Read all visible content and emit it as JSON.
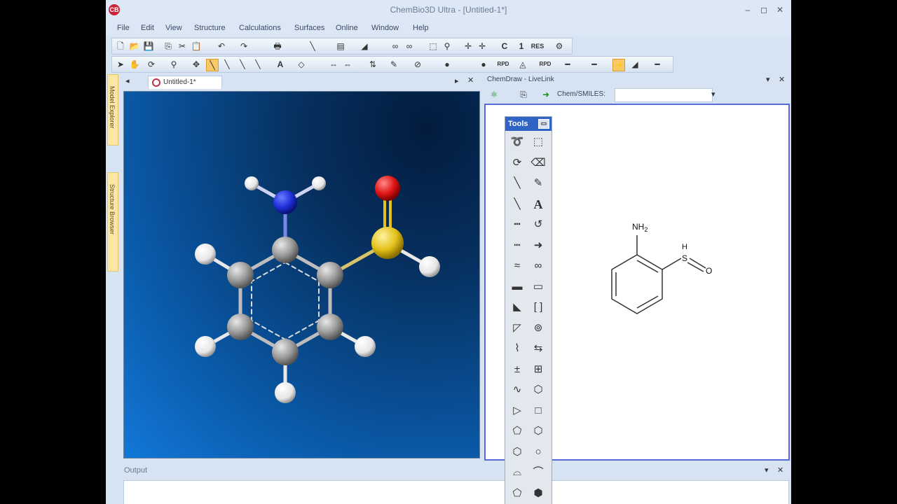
{
  "app": {
    "title": "ChemBio3D Ultra - [Untitled-1*]",
    "icon": "chembio-logo-icon",
    "window_buttons": [
      "–",
      "◻",
      "✕"
    ]
  },
  "menu": [
    "File",
    "Edit",
    "View",
    "Structure",
    "Calculations",
    "Surfaces",
    "Online",
    "Window",
    "Help"
  ],
  "side_tabs": [
    "Model Explorer",
    "Structure Browser"
  ],
  "document": {
    "tab_label": "Untitled-1*"
  },
  "model3d": {
    "atoms": [
      {
        "id": "C1",
        "element": "C",
        "color": "#9a9a9a"
      },
      {
        "id": "C2",
        "element": "C",
        "color": "#9a9a9a"
      },
      {
        "id": "C3",
        "element": "C",
        "color": "#9a9a9a"
      },
      {
        "id": "C4",
        "element": "C",
        "color": "#9a9a9a"
      },
      {
        "id": "C5",
        "element": "C",
        "color": "#9a9a9a"
      },
      {
        "id": "C6",
        "element": "C",
        "color": "#9a9a9a"
      },
      {
        "id": "N",
        "element": "N",
        "color": "#1f2fd8"
      },
      {
        "id": "S",
        "element": "S",
        "color": "#e3c11a"
      },
      {
        "id": "O",
        "element": "O",
        "color": "#e01515"
      },
      {
        "id": "H1",
        "element": "H",
        "color": "#ffffff"
      },
      {
        "id": "H2",
        "element": "H",
        "color": "#ffffff"
      },
      {
        "id": "H3",
        "element": "H",
        "color": "#ffffff"
      },
      {
        "id": "H4",
        "element": "H",
        "color": "#ffffff"
      },
      {
        "id": "H5",
        "element": "H",
        "color": "#ffffff"
      },
      {
        "id": "H6",
        "element": "H",
        "color": "#ffffff"
      },
      {
        "id": "H7",
        "element": "H",
        "color": "#ffffff"
      }
    ]
  },
  "livelink": {
    "title": "ChemDraw - LiveLink",
    "smiles_label": "Chem/SMILES:",
    "smiles_value": "",
    "structure_labels": {
      "nh2": "NH2",
      "s": "S",
      "h": "H",
      "o": "O"
    }
  },
  "tools_palette": {
    "title": "Tools",
    "tools": [
      "lasso-icon",
      "marquee-icon",
      "rotate-icon",
      "eraser-icon",
      "bond-icon",
      "pen-icon",
      "bold-bond-icon",
      "text-icon",
      "dashed-bond-icon",
      "lasso-rotate-icon",
      "hashed-bond-icon",
      "arrow-icon",
      "wavy-bond-icon",
      "orbital-icon",
      "bold-line-icon",
      "rectangle-icon",
      "wedge-bond-icon",
      "bracket-icon",
      "hollow-wedge-icon",
      "atom-map-icon",
      "chain-icon",
      "shape-icon",
      "charge-icon",
      "table-icon",
      "squiggle-icon",
      "template-icon",
      "triangle-icon",
      "square-icon",
      "pentagon-icon",
      "hexagon-icon",
      "cyclohexane-icon",
      "circle-icon",
      "boat-icon",
      "chair-icon",
      "heptagon-icon",
      "cyclooctane-icon"
    ]
  },
  "output": {
    "title": "Output"
  }
}
